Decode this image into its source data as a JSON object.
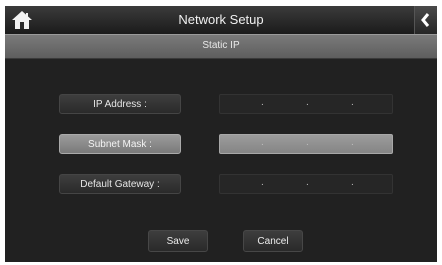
{
  "header": {
    "title": "Network Setup",
    "home_icon": "home-icon",
    "back_icon": "chevron-left-icon"
  },
  "subheader": {
    "title": "Static IP"
  },
  "form": {
    "ip_address": {
      "label": "IP Address :",
      "separator": "."
    },
    "subnet_mask": {
      "label": "Subnet Mask :",
      "separator": "."
    },
    "default_gateway": {
      "label": "Default Gateway :",
      "separator": "."
    }
  },
  "actions": {
    "save_label": "Save",
    "cancel_label": "Cancel"
  },
  "colors": {
    "background": "#212121",
    "highlight": "#8a8a8a",
    "text": "#e6e6e6"
  }
}
